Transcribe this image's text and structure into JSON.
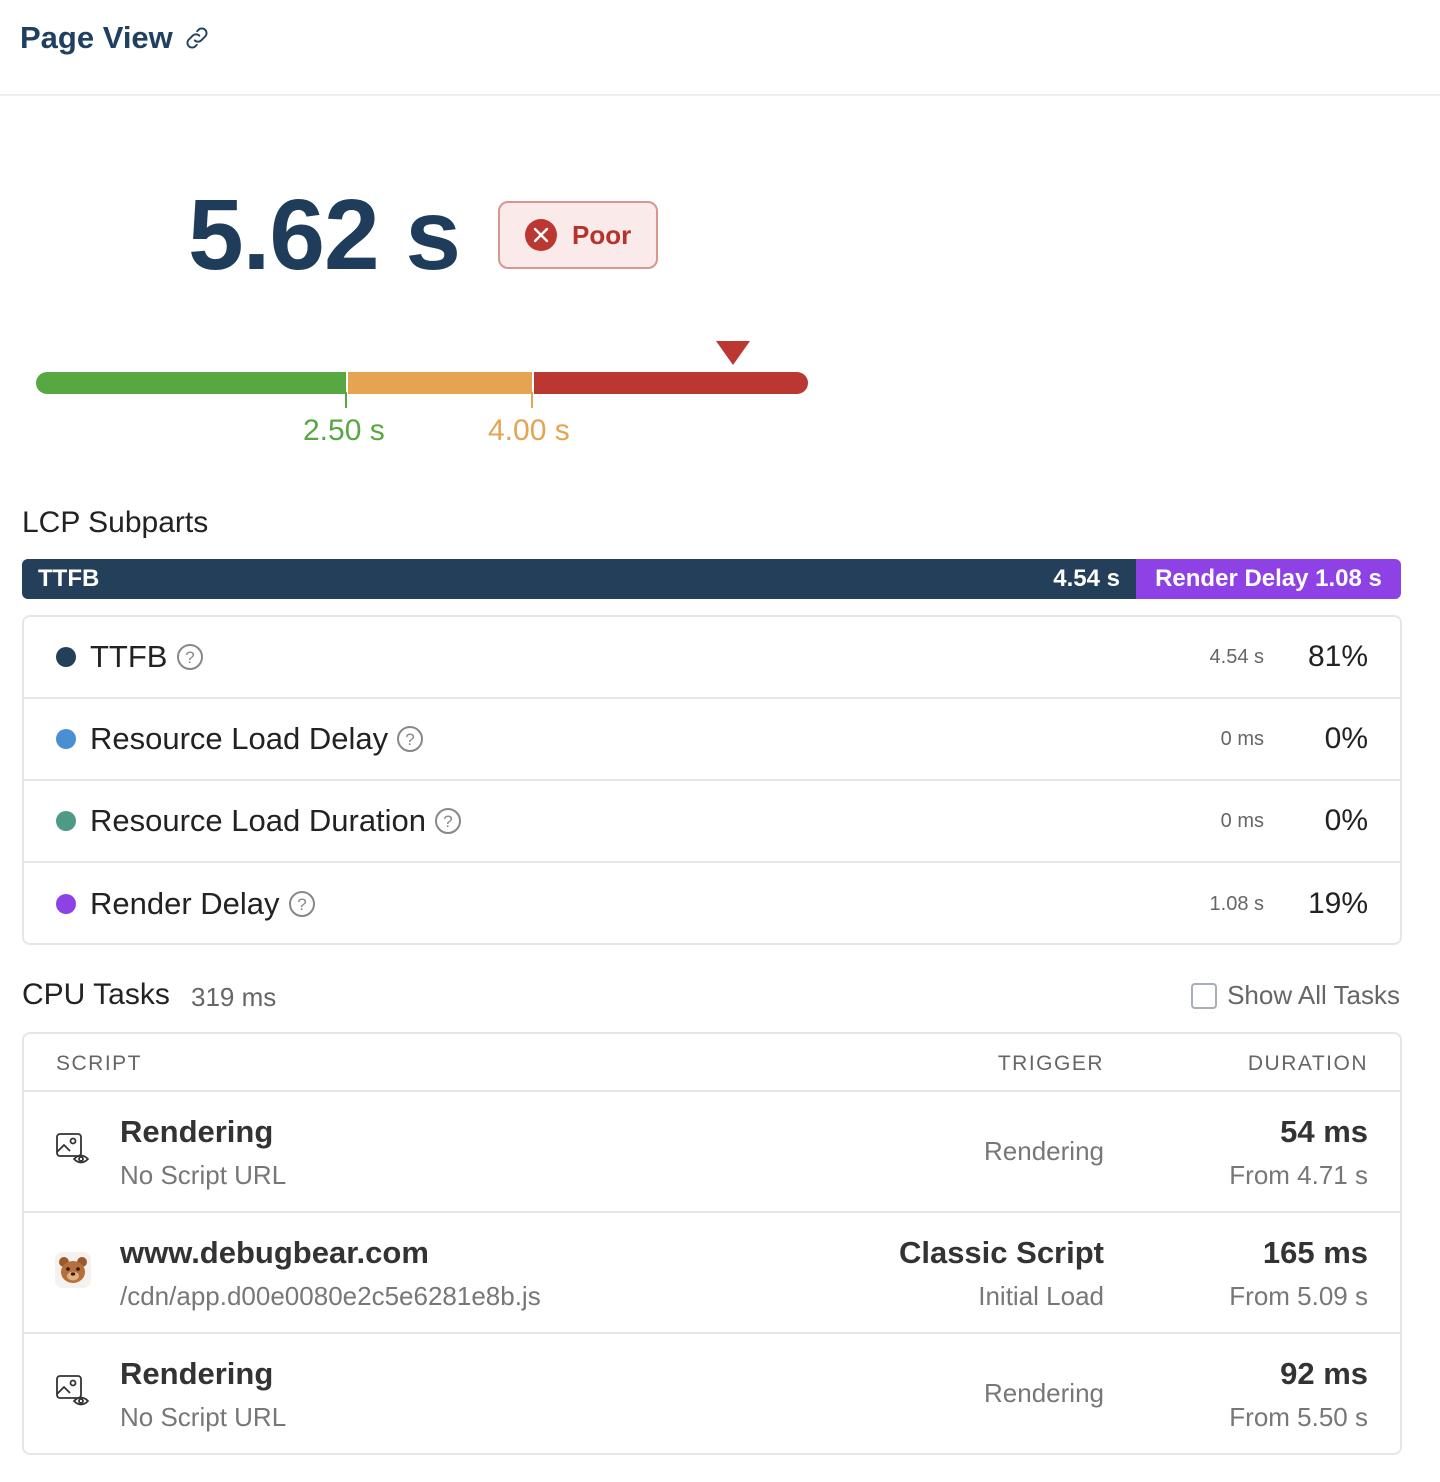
{
  "header": {
    "title": "Page View",
    "link_icon": "link-icon"
  },
  "metric": {
    "value": "5.62 s",
    "rating": "Poor",
    "rating_color": "#bb3731",
    "good_threshold_label": "2.50 s",
    "ni_threshold_label": "4.00 s",
    "colors": {
      "good": "#57a843",
      "needs_improvement": "#e5a452",
      "poor": "#bb3731"
    }
  },
  "lcp_subparts": {
    "title": "LCP Subparts",
    "bar": {
      "ttfb_label": "TTFB",
      "ttfb_value": "4.54 s",
      "render_label": "Render Delay 1.08 s"
    },
    "rows": [
      {
        "name": "TTFB",
        "time": "4.54 s",
        "pct": "81%",
        "color": "#243f5a"
      },
      {
        "name": "Resource Load Delay",
        "time": "0 ms",
        "pct": "0%",
        "color": "#4a8fd4"
      },
      {
        "name": "Resource Load Duration",
        "time": "0 ms",
        "pct": "0%",
        "color": "#4f9a86"
      },
      {
        "name": "Render Delay",
        "time": "1.08 s",
        "pct": "19%",
        "color": "#8e42e6"
      }
    ]
  },
  "cpu_tasks": {
    "title": "CPU Tasks",
    "total": "319 ms",
    "show_all_label": "Show All Tasks",
    "columns": {
      "script": "SCRIPT",
      "trigger": "TRIGGER",
      "duration": "DURATION"
    },
    "rows": [
      {
        "icon": "rendering-icon",
        "name": "Rendering",
        "url": "No Script URL",
        "trigger": "Rendering",
        "trigger_sub": "",
        "duration": "54 ms",
        "from": "From 4.71 s"
      },
      {
        "icon": "debugbear-favicon-icon",
        "name": "www.debugbear.com",
        "url": "/cdn/app.d00e0080e2c5e6281e8b.js",
        "trigger": "Classic Script",
        "trigger_sub": "Initial Load",
        "duration": "165 ms",
        "from": "From 5.09 s"
      },
      {
        "icon": "rendering-icon",
        "name": "Rendering",
        "url": "No Script URL",
        "trigger": "Rendering",
        "trigger_sub": "",
        "duration": "92 ms",
        "from": "From 5.50 s"
      }
    ]
  }
}
